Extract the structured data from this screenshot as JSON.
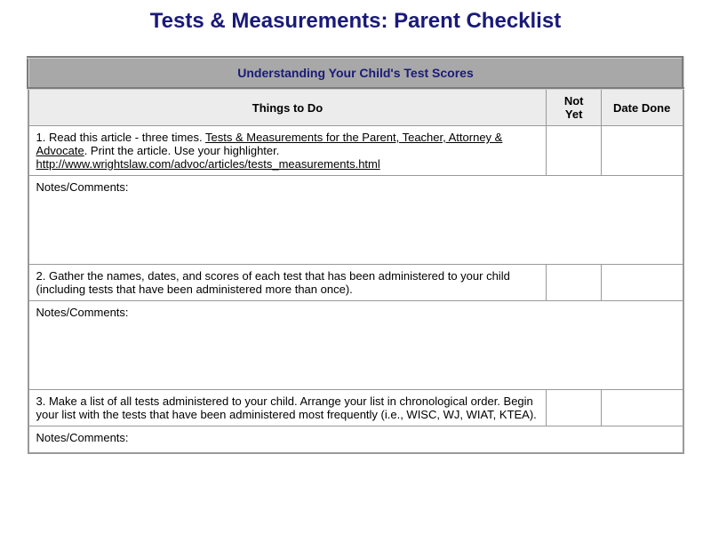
{
  "title": "Tests & Measurements: Parent Checklist",
  "sectionHeader": "Understanding Your Child's Test Scores",
  "columns": {
    "things": "Things to Do",
    "notYet": "Not Yet",
    "dateDone": "Date Done"
  },
  "notesLabel": "Notes/Comments:",
  "items": [
    {
      "prefix": "1. Read this article - three times.  ",
      "link1": "Tests & Measurements for the Parent, Teacher, Attorney & Advocate",
      "mid": ". Print the article. Use your highlighter. ",
      "link2": "http://www.wrightslaw.com/advoc/articles/tests_measurements.html"
    },
    {
      "text": "2. Gather the names, dates, and scores of each test that has been administered to your child (including tests that have been administered more than once)."
    },
    {
      "text": "3. Make a list of all tests administered to your child. Arrange your list in chronological order. Begin your list with the tests that have been administered most frequently (i.e., WISC, WJ, WIAT, KTEA)."
    }
  ]
}
